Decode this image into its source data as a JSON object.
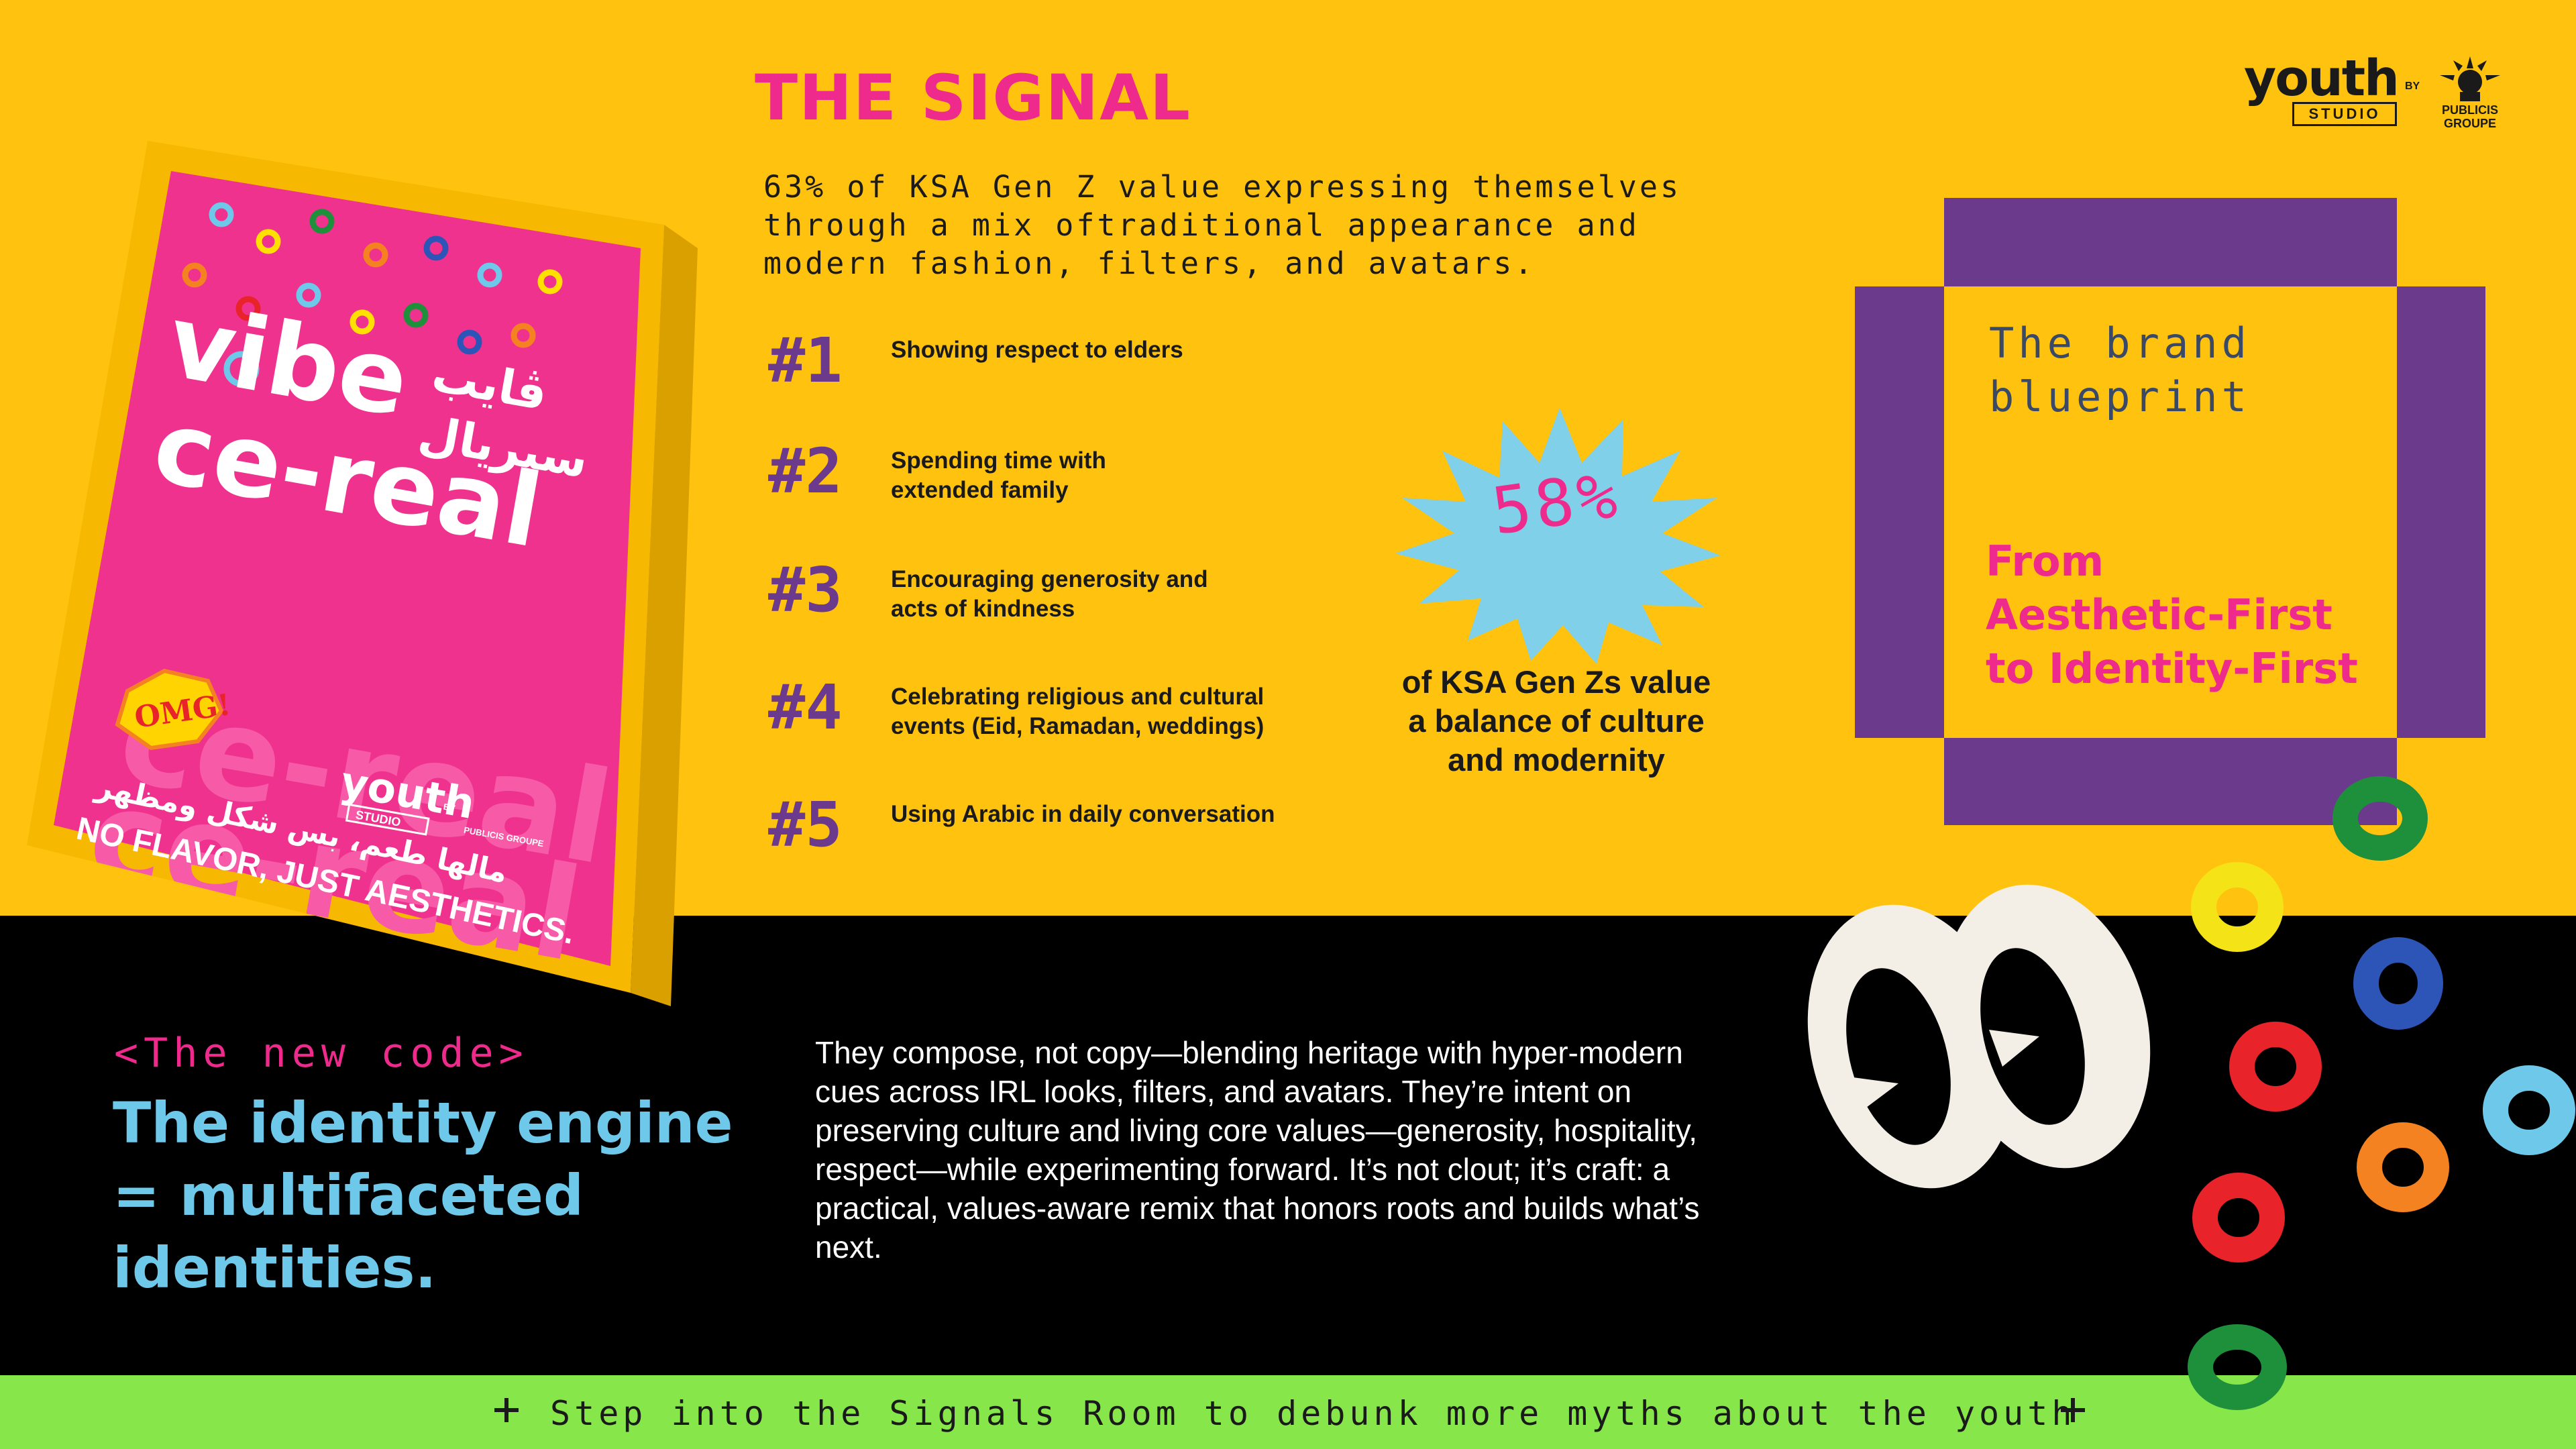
{
  "header": {
    "title": "THE SIGNAL",
    "intro": "63% of KSA Gen Z value expressing themselves\nthrough a mix oftraditional appearance and\nmodern fashion, filters, and avatars."
  },
  "logo": {
    "wordmark": "youth",
    "studio": "STUDIO",
    "by": "BY",
    "partner": "PUBLICIS\nGROUPE"
  },
  "ranks": [
    {
      "num": "#1",
      "text": "Showing respect to elders"
    },
    {
      "num": "#2",
      "text": "Spending time with\nextended family"
    },
    {
      "num": "#3",
      "text": "Encouraging generosity and\nacts of kindness"
    },
    {
      "num": "#4",
      "text": "Celebrating religious and cultural\nevents (Eid, Ramadan, weddings)"
    },
    {
      "num": "#5",
      "text": "Using Arabic in daily conversation"
    }
  ],
  "stat": {
    "value": "58%",
    "caption": "of KSA Gen Zs value\na balance of culture\nand modernity"
  },
  "blueprint": {
    "tag": "The brand\nblueprint",
    "headline": "From\nAesthetic-First\nto Identity-First"
  },
  "cereal_box": {
    "line1": "vibe",
    "line2": "ce-real",
    "arabic_line1": "ڤايب",
    "arabic_line2": "سيريال",
    "badge": "OMG!",
    "brand": "youth",
    "brand_studio": "STUDIO",
    "brand_by": "BY",
    "brand_partner": "PUBLICIS GROUPE",
    "tagline_ar": "مالها طعم، بس شكل ومظهر",
    "tagline_en": "NO FLAVOR, JUST AESTHETICS."
  },
  "new_code": {
    "tag": "<The new code>",
    "title": "The identity engine\n= multifaceted\nidentities.",
    "body": "They compose, not copy—blending heritage with hyper-modern cues across IRL looks, filters, and avatars. They’re intent on preserving culture and living core values—generosity, hospitality, respect—while experimenting forward. It’s not clout; it’s craft: a practical, values-aware remix that honors roots and builds what’s next."
  },
  "footer": {
    "text": "Step into the Signals Room to debunk more myths about the youth"
  },
  "colors": {
    "background": "#ffc20e",
    "pink": "#ee2a8d",
    "purple": "#6b3a8c",
    "sky": "#6ec8ea",
    "black": "#000000",
    "green": "#86e64a"
  }
}
